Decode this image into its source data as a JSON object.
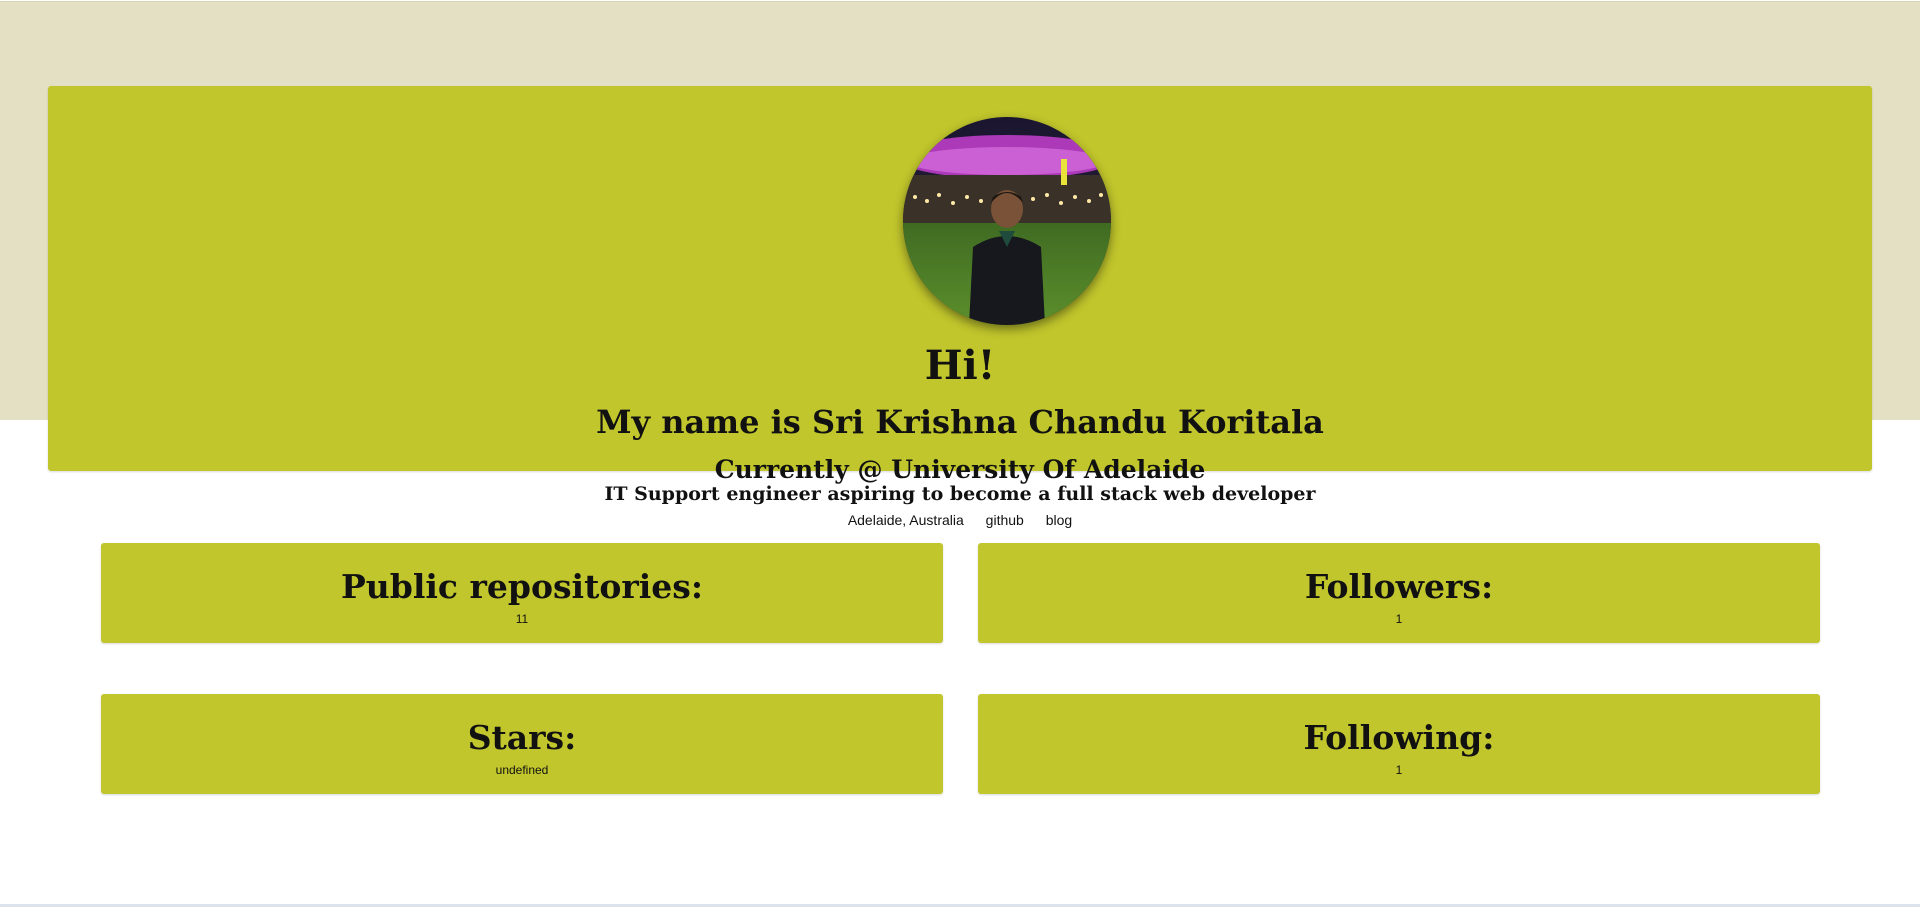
{
  "hero": {
    "greeting": "Hi!",
    "name": "My name is Sri Krishna Chandu Koritala",
    "current": "Currently @ University Of Adelaide",
    "location": "Adelaide, Australia",
    "github_label": "github",
    "blog_label": "blog"
  },
  "bio": "IT Support engineer aspiring to become a full stack web developer",
  "stats": {
    "repos": {
      "label": "Public repositories:",
      "value": "11"
    },
    "followers": {
      "label": "Followers:",
      "value": "1"
    },
    "stars": {
      "label": "Stars:",
      "value": "undefined"
    },
    "following": {
      "label": "Following:",
      "value": "1"
    }
  },
  "colors": {
    "accent": "#c1c62c",
    "band": "#e4e0c3",
    "text": "#111111"
  }
}
